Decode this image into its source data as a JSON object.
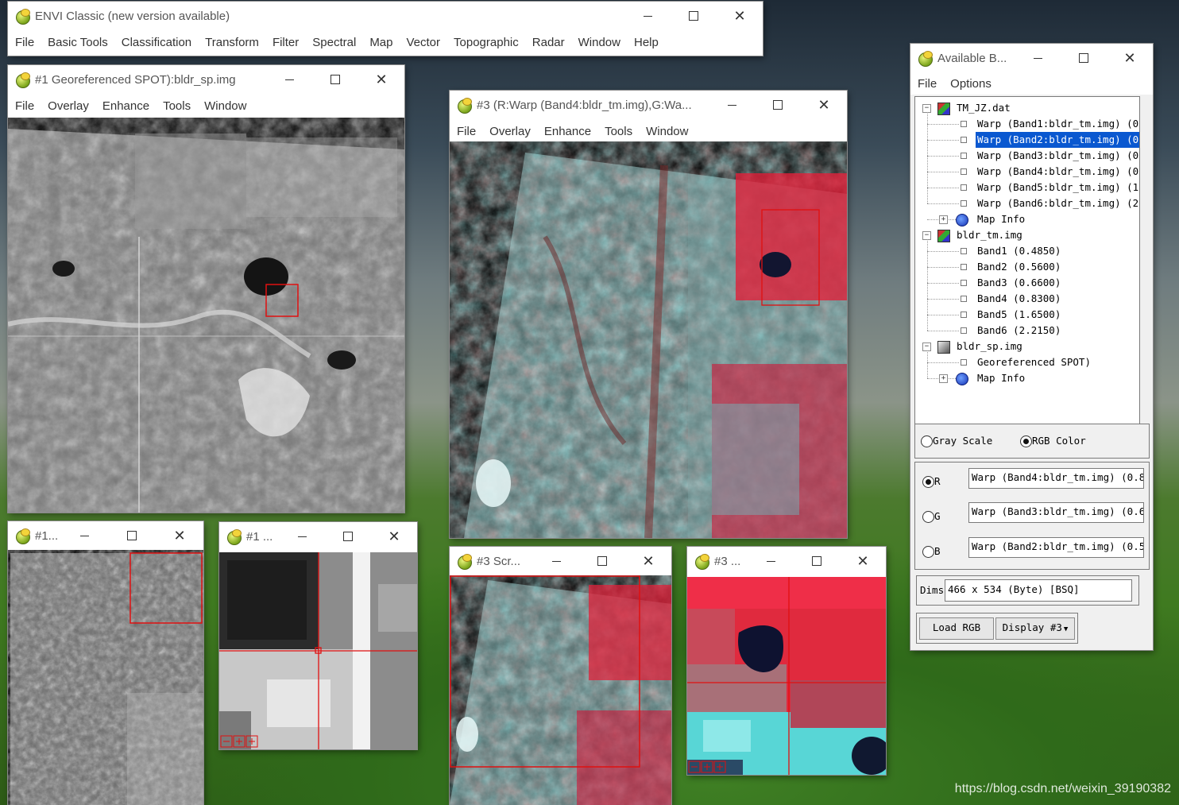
{
  "main_window": {
    "title": "ENVI Classic (new version available)",
    "menus": [
      "File",
      "Basic Tools",
      "Classification",
      "Transform",
      "Filter",
      "Spectral",
      "Map",
      "Vector",
      "Topographic",
      "Radar",
      "Window",
      "Help"
    ]
  },
  "display1_image": {
    "title": "#1 Georeferenced SPOT):bldr_sp.img",
    "menus": [
      "File",
      "Overlay",
      "Enhance",
      "Tools",
      "Window"
    ]
  },
  "display3_image": {
    "title": "#3 (R:Warp (Band4:bldr_tm.img),G:Wa...",
    "menus": [
      "File",
      "Overlay",
      "Enhance",
      "Tools",
      "Window"
    ]
  },
  "display1_scroll": {
    "title": "#1..."
  },
  "display1_zoom": {
    "title": "#1 ..."
  },
  "display3_scroll": {
    "title": "#3 Scr..."
  },
  "display3_zoom": {
    "title": "#3 ..."
  },
  "band_list": {
    "title": "Available B...",
    "menus": [
      "File",
      "Options"
    ],
    "tree": [
      {
        "label": "TM_JZ.dat",
        "level": 0,
        "expander": "−"
      },
      {
        "label": "Warp (Band1:bldr_tm.img) (0",
        "level": 1
      },
      {
        "label": "Warp (Band2:bldr_tm.img) (0",
        "level": 1,
        "selected": true
      },
      {
        "label": "Warp (Band3:bldr_tm.img) (0",
        "level": 1
      },
      {
        "label": "Warp (Band4:bldr_tm.img) (0",
        "level": 1
      },
      {
        "label": "Warp (Band5:bldr_tm.img) (1",
        "level": 1
      },
      {
        "label": "Warp (Band6:bldr_tm.img) (2",
        "level": 1
      },
      {
        "label": "Map Info",
        "level": 1,
        "expander": "+",
        "globe": true
      },
      {
        "label": "bldr_tm.img",
        "level": 0,
        "expander": "−"
      },
      {
        "label": "Band1 (0.4850)",
        "level": 1
      },
      {
        "label": "Band2 (0.5600)",
        "level": 1
      },
      {
        "label": "Band3 (0.6600)",
        "level": 1
      },
      {
        "label": "Band4 (0.8300)",
        "level": 1
      },
      {
        "label": "Band5 (1.6500)",
        "level": 1
      },
      {
        "label": "Band6 (2.2150)",
        "level": 1
      },
      {
        "label": "bldr_sp.img",
        "level": 0,
        "expander": "−",
        "gray": true
      },
      {
        "label": "Georeferenced SPOT)",
        "level": 1
      },
      {
        "label": "Map Info",
        "level": 1,
        "expander": "+",
        "globe": true
      }
    ],
    "mode_gray": "Gray Scale",
    "mode_rgb": "RGB Color",
    "r_label": "R",
    "g_label": "G",
    "b_label": "B",
    "r_value": "Warp (Band4:bldr_tm.img) (0.8",
    "g_value": "Warp (Band3:bldr_tm.img) (0.6",
    "b_value": "Warp (Band2:bldr_tm.img) (0.5",
    "dims_label": "Dims",
    "dims_value": "466 x 534 (Byte) [BSQ]",
    "load_button": "Load RGB",
    "display_button": "Display #3"
  },
  "watermark": "https://blog.csdn.net/weixin_39190382"
}
